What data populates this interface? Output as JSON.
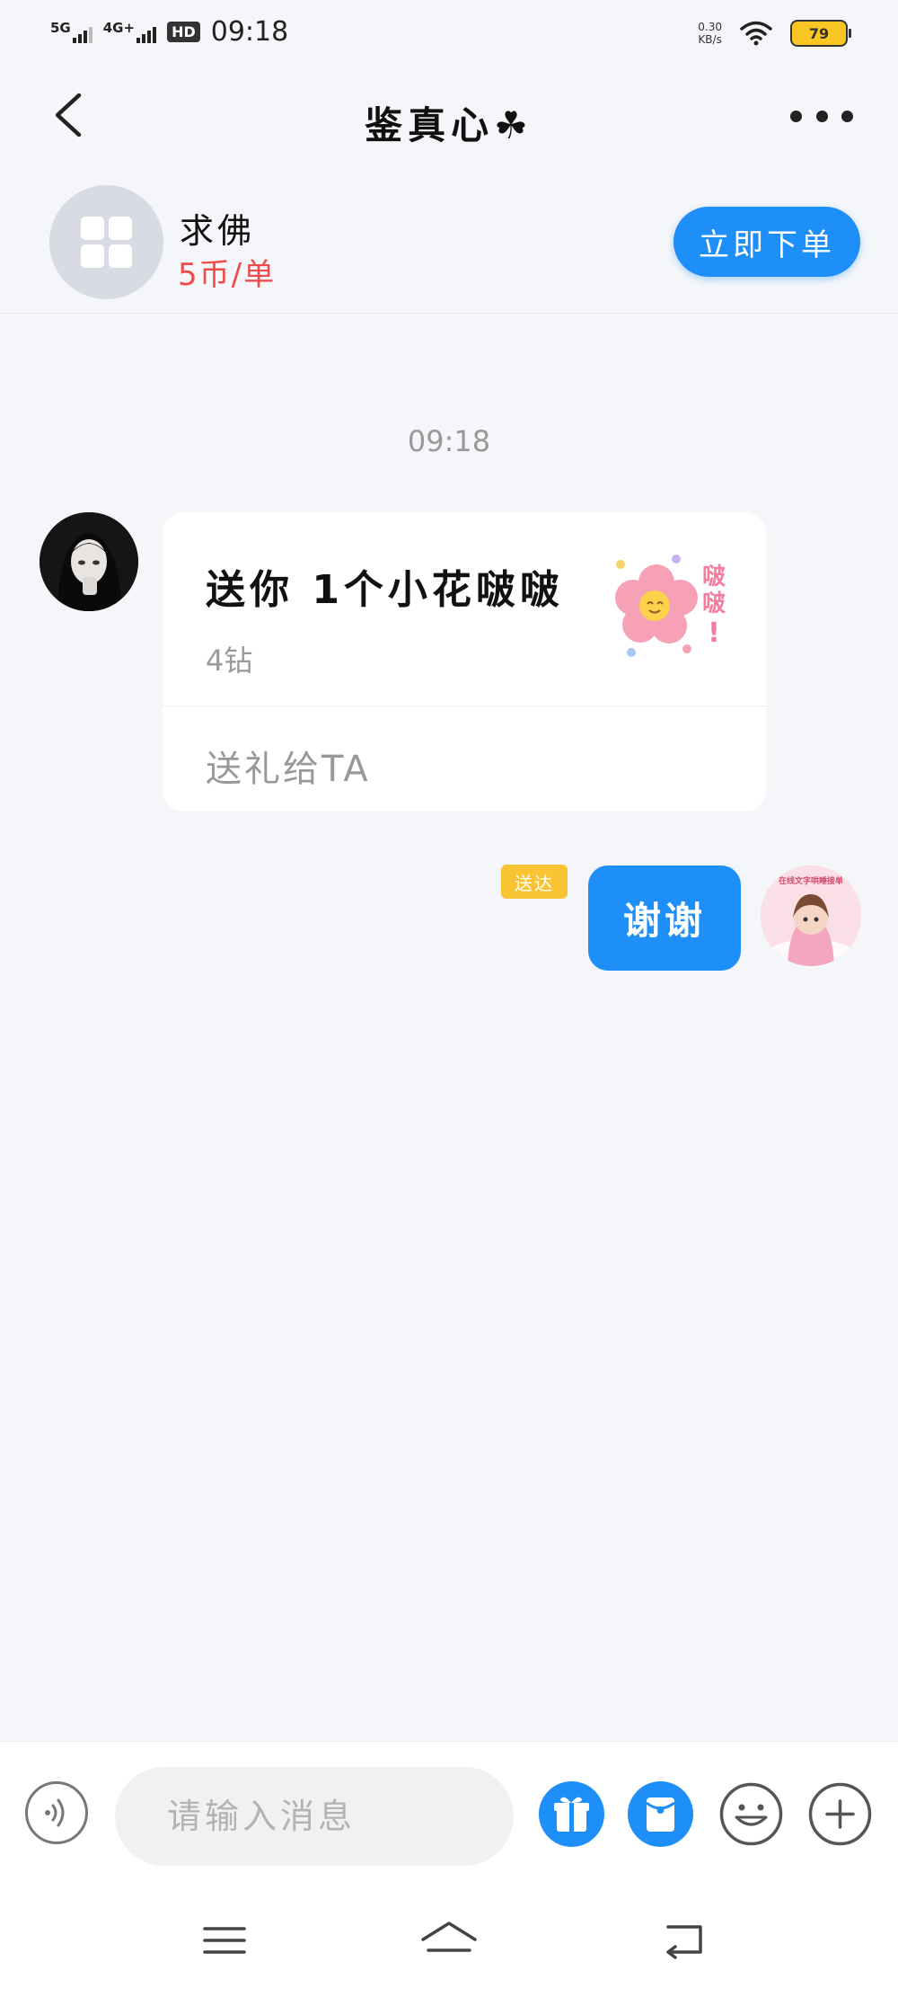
{
  "status_bar": {
    "sim1_label": "5G",
    "sim2_label": "4G+",
    "hd_label": "HD",
    "time": "09:18",
    "net_speed_value": "0.30",
    "net_speed_unit": "KB/s",
    "battery": "79"
  },
  "header": {
    "title": "鉴真心☘",
    "back_icon": "chevron-left-icon",
    "more_icon": "more-horizontal-icon"
  },
  "service": {
    "icon": "apps-grid-icon",
    "name": "求佛",
    "price": "5币/单",
    "order_button": "立即下单"
  },
  "chat": {
    "timestamp": "09:18",
    "gift_message": {
      "title": "送你 1个小花啵啵",
      "price": "4钻",
      "action": "送礼给TA",
      "image_text": "啵啵!"
    },
    "delivered_badge": "送达",
    "outgoing_message": "谢谢",
    "avatar_right_text": "在线文字哄睡接单"
  },
  "input_bar": {
    "placeholder": "请输入消息",
    "voice_icon": "voice-icon",
    "gift_icon": "gift-icon",
    "red_packet_icon": "red-packet-icon",
    "emoji_icon": "emoji-icon",
    "plus_icon": "plus-icon"
  },
  "nav_bar": {
    "menu_icon": "menu-icon",
    "home_icon": "home-icon",
    "back_icon": "back-icon"
  },
  "colors": {
    "accent": "#1e8ef8",
    "price_red": "#f24a4a",
    "badge_yellow": "#f8c434",
    "background": "#f4f6f9"
  }
}
